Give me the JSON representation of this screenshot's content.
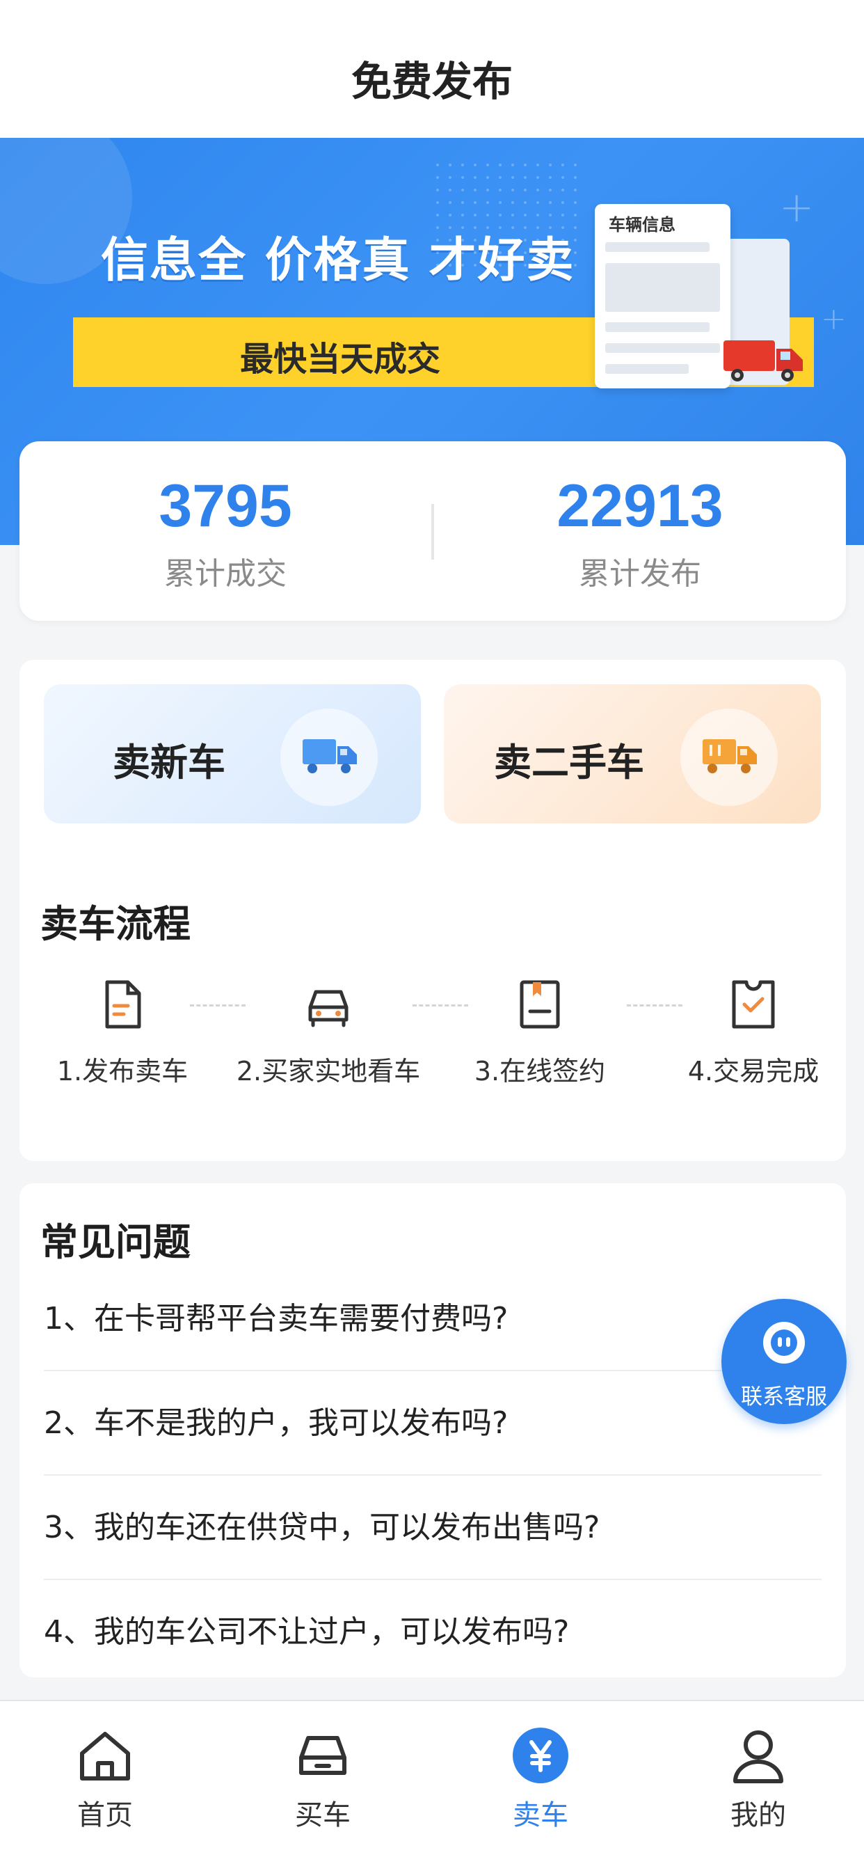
{
  "header": {
    "title": "免费发布"
  },
  "banner": {
    "headline": "信息全 价格真 才好卖",
    "subline": "最快当天成交",
    "doc_title": "车辆信息"
  },
  "stats": [
    {
      "value": "3795",
      "label": "累计成交"
    },
    {
      "value": "22913",
      "label": "累计发布"
    }
  ],
  "sell": {
    "new_label": "卖新车",
    "used_label": "卖二手车",
    "process_title": "卖车流程",
    "steps": [
      {
        "label": "1.发布卖车",
        "icon": "document-icon"
      },
      {
        "label": "2.买家实地看车",
        "icon": "car-icon"
      },
      {
        "label": "3.在线签约",
        "icon": "contract-icon"
      },
      {
        "label": "4.交易完成",
        "icon": "check-icon"
      }
    ]
  },
  "faq": {
    "title": "常见问题",
    "items": [
      "1、在卡哥帮平台卖车需要付费吗?",
      "2、车不是我的户，我可以发布吗?",
      "3、我的车还在供贷中，可以发布出售吗?",
      "4、我的车公司不让过户，可以发布吗?"
    ]
  },
  "customer_service": {
    "label": "联系客服"
  },
  "tabbar": {
    "items": [
      {
        "label": "首页",
        "icon": "home-icon"
      },
      {
        "label": "买车",
        "icon": "car-icon"
      },
      {
        "label": "卖车",
        "icon": "yuan-icon",
        "active": true
      },
      {
        "label": "我的",
        "icon": "user-icon"
      }
    ]
  },
  "colors": {
    "accent": "#2f82eb",
    "banner_yellow": "#ffd22b"
  }
}
